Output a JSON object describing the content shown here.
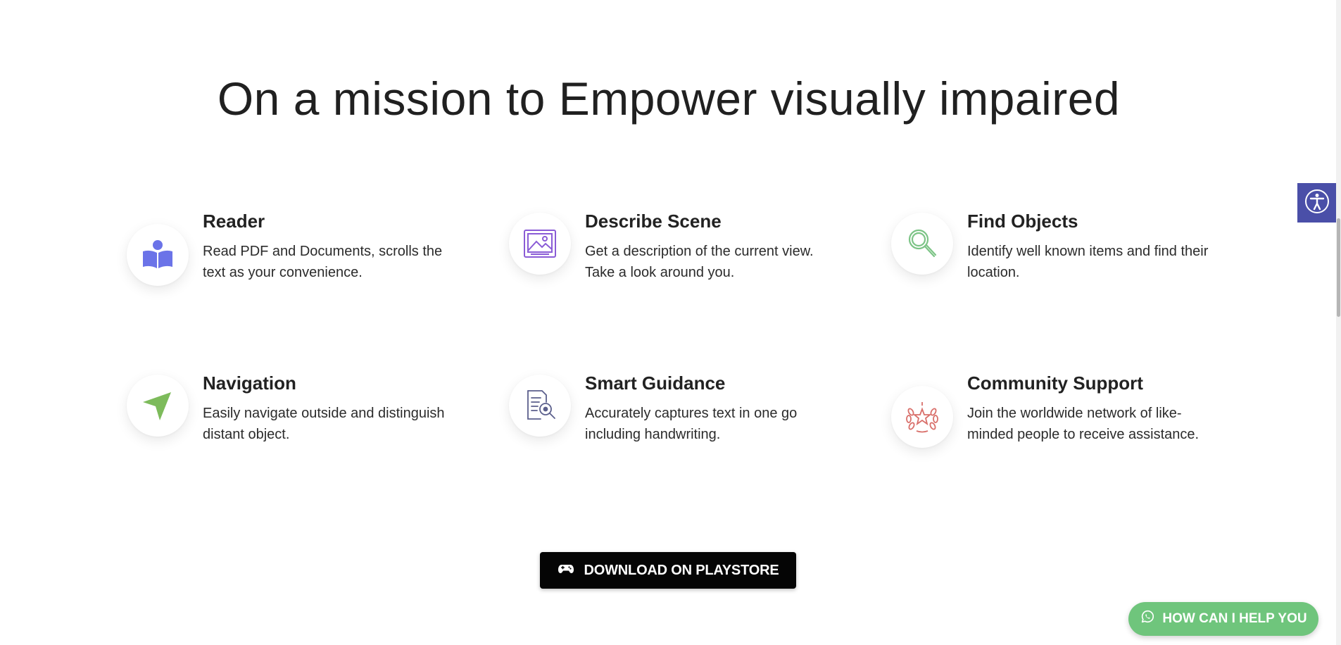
{
  "headline": "On a mission to Empower visually impaired",
  "features": [
    {
      "title": "Reader",
      "desc": "Read PDF and Documents, scrolls the text as your convenience.",
      "icon": "reader-icon",
      "color": "#6b73e8"
    },
    {
      "title": "Describe Scene",
      "desc": "Get a description of the current view. Take a look around you.",
      "icon": "image-icon",
      "color": "#8a5cd6"
    },
    {
      "title": "Find Objects",
      "desc": "Identify well known items and find their location.",
      "icon": "magnifier-icon",
      "color": "#7cc486"
    },
    {
      "title": "Navigation",
      "desc": "Easily navigate outside and distinguish distant object.",
      "icon": "navigation-icon",
      "color": "#7dbb5b"
    },
    {
      "title": "Smart Guidance",
      "desc": "Accurately captures text in one go including handwriting.",
      "icon": "document-search-icon",
      "color": "#5b5f8c"
    },
    {
      "title": "Community Support",
      "desc": "Join the worldwide network of like-minded people to receive assistance.",
      "icon": "laurel-star-icon",
      "color": "#d9706b"
    }
  ],
  "cta": {
    "label": "DOWNLOAD ON PLAYSTORE",
    "icon": "gamepad-icon",
    "background": "#050505"
  },
  "accessibility_button": {
    "icon": "accessibility-icon",
    "background": "#4a4fa8"
  },
  "help_button": {
    "label": "HOW CAN I HELP YOU",
    "icon": "whatsapp-icon",
    "background": "#6fc57c"
  }
}
